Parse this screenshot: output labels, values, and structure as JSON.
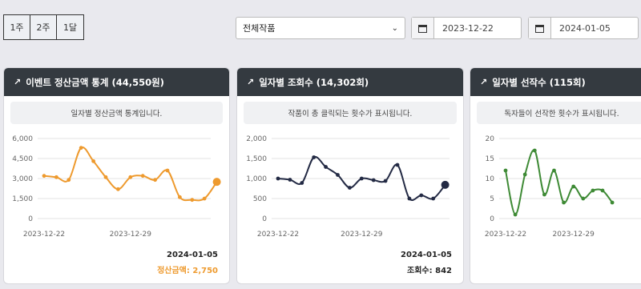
{
  "range_buttons": [
    "1주",
    "2주",
    "1달"
  ],
  "filter": {
    "selected": "전체작품"
  },
  "date_start": "2023-12-22",
  "date_end": "2024-01-05",
  "cards": [
    {
      "title": "이벤트 정산금액 통계 (44,550원)",
      "notice": "일자별 정산금액 통계입니다.",
      "footer_date": "2024-01-05",
      "footer_value": "정산금액: 2,750",
      "color": "#ee9a2e"
    },
    {
      "title": "일자별 조회수 (14,302회)",
      "notice": "작품이 총 클릭되는 횟수가 표시됩니다.",
      "footer_date": "2024-01-05",
      "footer_value": "조회수: 842",
      "color": "#232a44"
    },
    {
      "title": "일자별 선작수 (115회)",
      "notice": "독자들이 선작한 횟수가 표시됩니다.",
      "footer_date": "",
      "footer_value": "",
      "color": "#3e8a35"
    }
  ],
  "chart_data": [
    {
      "type": "line",
      "x": [
        "2023-12-22",
        "2023-12-23",
        "2023-12-24",
        "2023-12-25",
        "2023-12-26",
        "2023-12-27",
        "2023-12-28",
        "2023-12-29",
        "2023-12-30",
        "2023-12-31",
        "2024-01-01",
        "2024-01-02",
        "2024-01-03",
        "2024-01-04",
        "2024-01-05"
      ],
      "series": [
        {
          "values": [
            3200,
            3100,
            2900,
            5300,
            4300,
            3100,
            2200,
            3100,
            3200,
            2900,
            3600,
            1600,
            1400,
            1500,
            2750
          ]
        }
      ],
      "yticks": [
        "6,000",
        "4,500",
        "3,000",
        "1,500",
        "0"
      ],
      "ylim": [
        0,
        6000
      ],
      "xticks": [
        "2023-12-22",
        "2023-12-29"
      ]
    },
    {
      "type": "line",
      "x": [
        "2023-12-22",
        "2023-12-23",
        "2023-12-24",
        "2023-12-25",
        "2023-12-26",
        "2023-12-27",
        "2023-12-28",
        "2023-12-29",
        "2023-12-30",
        "2023-12-31",
        "2024-01-01",
        "2024-01-02",
        "2024-01-03",
        "2024-01-04",
        "2024-01-05"
      ],
      "series": [
        {
          "values": [
            1000,
            970,
            890,
            1530,
            1290,
            1090,
            770,
            1000,
            960,
            940,
            1340,
            500,
            580,
            500,
            842
          ]
        }
      ],
      "yticks": [
        "2,000",
        "1,500",
        "1,000",
        "500",
        "0"
      ],
      "ylim": [
        0,
        2000
      ],
      "xticks": [
        "2023-12-22",
        "2023-12-29"
      ]
    },
    {
      "type": "line",
      "x": [
        "2023-12-22",
        "2023-12-23",
        "2023-12-24",
        "2023-12-25",
        "2023-12-26",
        "2023-12-27",
        "2023-12-28",
        "2023-12-29",
        "2023-12-30",
        "2023-12-31",
        "2024-01-01",
        "2024-01-02"
      ],
      "series": [
        {
          "values": [
            12,
            1,
            11,
            17,
            6,
            12,
            4,
            8,
            5,
            7,
            7,
            4
          ]
        }
      ],
      "yticks": [
        "20",
        "15",
        "10",
        "5",
        "0"
      ],
      "ylim": [
        0,
        20
      ],
      "xticks": [
        "2023-12-22",
        "2023-12-29"
      ]
    }
  ]
}
